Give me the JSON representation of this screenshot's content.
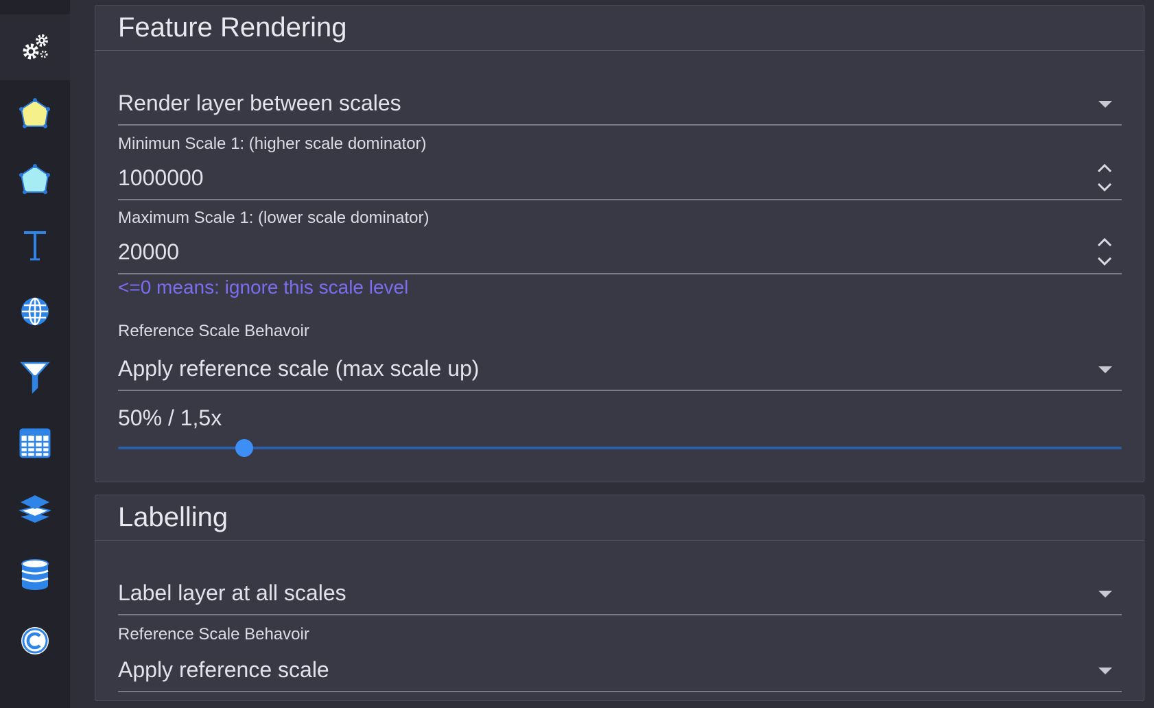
{
  "sidebar": {
    "items": [
      {
        "name": "settings",
        "icon": "gears-icon",
        "active": true
      },
      {
        "name": "fill-symbol",
        "icon": "yellow-polygon-icon"
      },
      {
        "name": "outline-symbol",
        "icon": "cyan-polygon-icon"
      },
      {
        "name": "label",
        "icon": "text-icon"
      },
      {
        "name": "projection",
        "icon": "globe-icon"
      },
      {
        "name": "filter",
        "icon": "funnel-icon"
      },
      {
        "name": "table",
        "icon": "table-icon"
      },
      {
        "name": "layers",
        "icon": "layers-icon"
      },
      {
        "name": "database",
        "icon": "database-icon"
      },
      {
        "name": "copyright",
        "icon": "copyright-icon"
      }
    ]
  },
  "feature_rendering": {
    "title": "Feature Rendering",
    "render_mode": "Render layer between scales",
    "min_scale_label": "Minimun Scale 1: (higher scale dominator)",
    "min_scale_value": "1000000",
    "max_scale_label": "Maximum Scale 1: (lower scale dominator)",
    "max_scale_value": "20000",
    "hint": "<=0 means: ignore this scale level",
    "ref_scale_label": "Reference Scale Behavoir",
    "ref_scale_value": "Apply reference scale (max scale up)",
    "slider_text": "50% / 1,5x",
    "slider_fraction": 0.126
  },
  "labelling": {
    "title": "Labelling",
    "label_mode": "Label layer at all scales",
    "ref_scale_label": "Reference Scale Behavoir",
    "ref_scale_value": "Apply reference scale"
  },
  "colors": {
    "accent": "#3d8ef5",
    "hint": "#7c6cf0",
    "panel": "#393945",
    "background": "#2f2f39",
    "sidebar": "#22222b"
  }
}
